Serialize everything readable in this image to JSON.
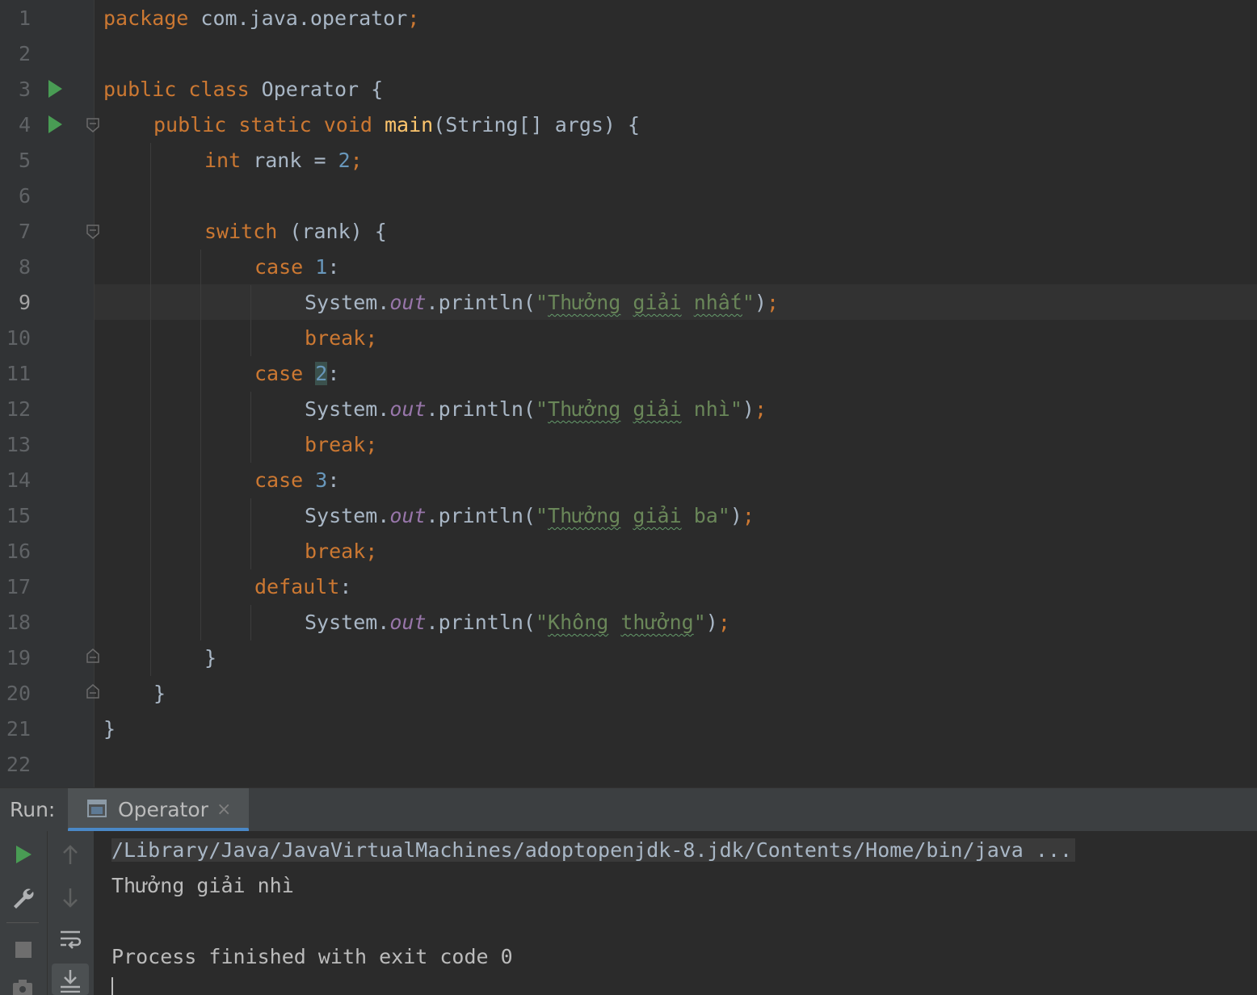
{
  "editor": {
    "current_line": 9,
    "line_numbers": [
      "1",
      "2",
      "3",
      "4",
      "5",
      "6",
      "7",
      "8",
      "9",
      "10",
      "11",
      "12",
      "13",
      "14",
      "15",
      "16",
      "17",
      "18",
      "19",
      "20",
      "21",
      "22"
    ],
    "code": {
      "l1_kw": "package",
      "l1_rest": " com.java.operator",
      "l1_semi": ";",
      "l3_kw": "public class",
      "l3_rest": " Operator {",
      "l4_kw": "public static void",
      "l4_fn": "main",
      "l4_rest": "(String[] args) {",
      "l5_kw": "int",
      "l5_mid": " rank = ",
      "l5_num": "2",
      "l5_semi": ";",
      "l7_kw": "switch",
      "l7_rest": " (rank) {",
      "l8_kw": "case",
      "l8_num": "1",
      "l8_colon": ":",
      "l9_a": "System.",
      "l9_fld": "out",
      "l9_b": ".println(",
      "l9_q1": "\"",
      "l9_w1": "Thưởng",
      "l9_w2": "giải",
      "l9_w3": "nhất",
      "l9_q2": "\"",
      "l9_c": ")",
      "l9_semi": ";",
      "l10_kw": "break",
      "l10_semi": ";",
      "l11_kw": "case",
      "l11_num": "2",
      "l11_colon": ":",
      "l12_a": "System.",
      "l12_fld": "out",
      "l12_b": ".println(",
      "l12_q1": "\"",
      "l12_w1": "Thưởng",
      "l12_w2": "giải",
      "l12_tail": " nhì\"",
      "l12_c": ")",
      "l12_semi": ";",
      "l13_kw": "break",
      "l13_semi": ";",
      "l14_kw": "case",
      "l14_num": "3",
      "l14_colon": ":",
      "l15_a": "System.",
      "l15_fld": "out",
      "l15_b": ".println(",
      "l15_q1": "\"",
      "l15_w1": "Thưởng",
      "l15_w2": "giải",
      "l15_tail": " ba\"",
      "l15_c": ")",
      "l15_semi": ";",
      "l16_kw": "break",
      "l16_semi": ";",
      "l17_kw": "default",
      "l17_colon": ":",
      "l18_a": "System.",
      "l18_fld": "out",
      "l18_b": ".println(",
      "l18_q1": "\"",
      "l18_w1": "Không",
      "l18_w2": "thưởng",
      "l18_q2": "\"",
      "l18_c": ")",
      "l18_semi": ";",
      "l19": "}",
      "l20": "}",
      "l21": "}"
    }
  },
  "run_panel": {
    "label": "Run:",
    "tab_label": "Operator",
    "tab_close": "×",
    "console": {
      "command": "/Library/Java/JavaVirtualMachines/adoptopenjdk-8.jdk/Contents/Home/bin/java ...",
      "output": "Thưởng giải nhì",
      "exit_message": "Process finished with exit code 0"
    }
  },
  "icons": {
    "run": "play-icon",
    "fold": "fold-marker-icon",
    "settings": "wrench-icon",
    "stop": "stop-icon",
    "camera": "camera-icon",
    "up": "arrow-up-icon",
    "down": "arrow-down-icon",
    "wrap": "soft-wrap-icon",
    "scroll_end": "scroll-to-end-icon"
  },
  "colors": {
    "background": "#2b2b2b",
    "keyword": "#cc7832",
    "function": "#ffc66d",
    "number": "#6897bb",
    "string": "#6a8759",
    "field": "#9876aa",
    "run_green": "#499c54",
    "tab_underline": "#4a88c7"
  }
}
